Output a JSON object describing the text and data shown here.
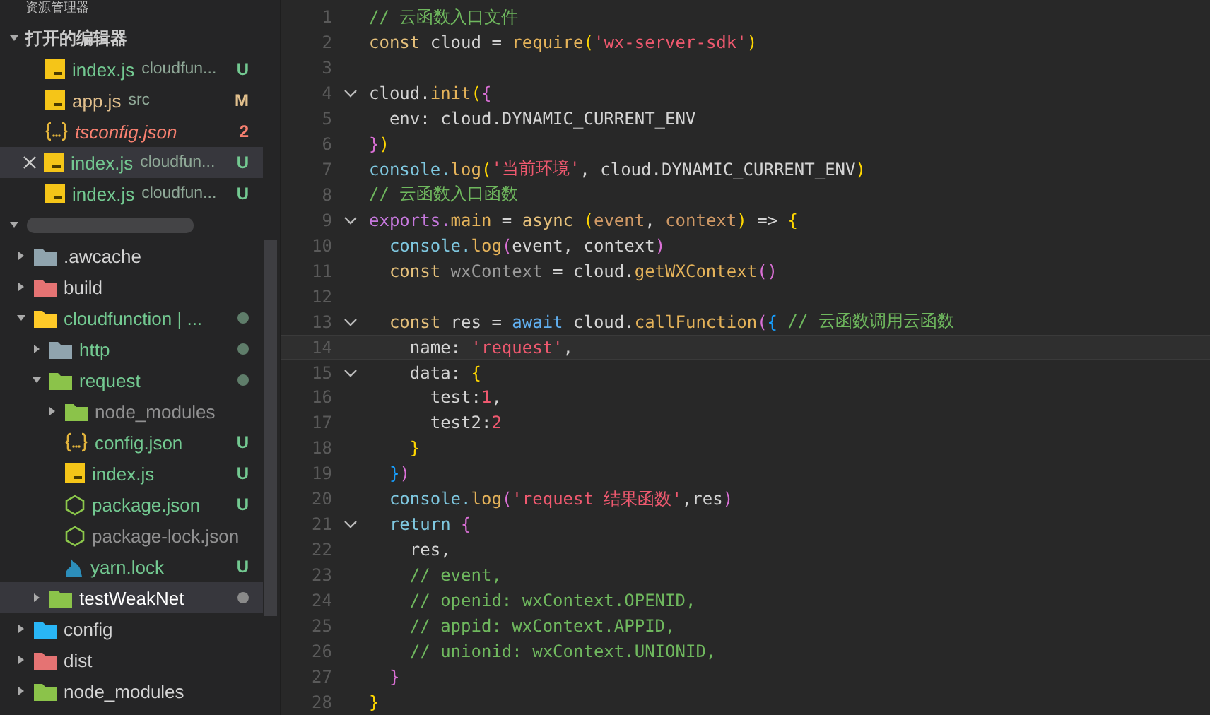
{
  "sidebar": {
    "title": "资源管理器",
    "open_editors": {
      "label": "打开的编辑器",
      "expanded": true,
      "items": [
        {
          "name": "index.js",
          "path": "cloudfun...",
          "badge": "U",
          "kind": "js",
          "color": "#73c991",
          "error": false,
          "selected": false
        },
        {
          "name": "app.js",
          "path": "src",
          "badge": "M",
          "kind": "js",
          "color": "#e2c08d",
          "error": false,
          "selected": false
        },
        {
          "name": "tsconfig.json",
          "badge": "2",
          "kind": "json",
          "color": "#f88070",
          "error": true,
          "selected": false
        },
        {
          "name": "index.js",
          "path": "cloudfun...",
          "badge": "U",
          "kind": "js",
          "color": "#73c991",
          "error": false,
          "selected": true
        },
        {
          "name": "index.js",
          "path": "cloudfun...",
          "badge": "U",
          "kind": "js",
          "color": "#73c991",
          "error": false,
          "selected": false
        }
      ]
    },
    "project": {
      "expanded": true
    },
    "tree": [
      {
        "name": ".awcache",
        "kind": "folder",
        "color": "#90a4ae",
        "expanded": false,
        "untracked": false,
        "ignored": false,
        "dot": false,
        "selected": false
      },
      {
        "name": "build",
        "kind": "folder",
        "color": "#e57373",
        "expanded": false,
        "untracked": false,
        "ignored": false,
        "dot": false,
        "selected": false
      },
      {
        "name": "cloudfunction | ...",
        "kind": "folder",
        "color": "#ffca28",
        "expanded": true,
        "untracked": true,
        "ignored": false,
        "dot": true,
        "selected": false,
        "children": [
          {
            "name": "http",
            "kind": "folder",
            "color": "#90a4ae",
            "expanded": false,
            "untracked": true,
            "ignored": false,
            "dot": true,
            "selected": false
          },
          {
            "name": "request",
            "kind": "folder",
            "color": "#8bc34a",
            "expanded": true,
            "untracked": true,
            "ignored": false,
            "dot": true,
            "selected": false,
            "children": [
              {
                "name": "node_modules",
                "kind": "folder",
                "color": "#8bc34a",
                "expanded": false,
                "untracked": false,
                "ignored": true,
                "dot": false,
                "selected": false
              },
              {
                "name": "config.json",
                "kind": "json",
                "badge": "U",
                "untracked": true,
                "ignored": false,
                "dot": false,
                "selected": false
              },
              {
                "name": "index.js",
                "kind": "js",
                "badge": "U",
                "untracked": true,
                "ignored": false,
                "dot": false,
                "selected": false
              },
              {
                "name": "package.json",
                "kind": "node",
                "badge": "U",
                "untracked": true,
                "ignored": false,
                "dot": false,
                "selected": false
              },
              {
                "name": "package-lock.json",
                "kind": "node",
                "untracked": false,
                "ignored": true,
                "dot": false,
                "selected": false
              },
              {
                "name": "yarn.lock",
                "kind": "yarn",
                "badge": "U",
                "untracked": true,
                "ignored": false,
                "dot": false,
                "selected": false
              }
            ]
          },
          {
            "name": "testWeakNet",
            "kind": "folder",
            "color": "#8bc34a",
            "expanded": false,
            "untracked": false,
            "ignored": false,
            "dot": true,
            "selected": true
          }
        ]
      },
      {
        "name": "config",
        "kind": "folder",
        "color": "#29b6f6",
        "expanded": false,
        "untracked": false,
        "ignored": false,
        "dot": false,
        "selected": false
      },
      {
        "name": "dist",
        "kind": "folder",
        "color": "#e57373",
        "expanded": false,
        "untracked": false,
        "ignored": false,
        "dot": false,
        "selected": false
      },
      {
        "name": "node_modules",
        "kind": "folder",
        "color": "#8bc34a",
        "expanded": false,
        "untracked": false,
        "ignored": false,
        "dot": false,
        "selected": false
      }
    ]
  },
  "editor": {
    "lines": [
      {
        "number": "1",
        "fold": false,
        "current": false,
        "tokens": [
          {
            "kind": "cm",
            "text": "// 云函数入口文件"
          }
        ]
      },
      {
        "number": "2",
        "fold": false,
        "current": false,
        "tokens": [
          {
            "kind": "kw",
            "text": "const"
          },
          {
            "kind": "pl",
            "text": " cloud = "
          },
          {
            "kind": "fn",
            "text": "require"
          },
          {
            "kind": "b1",
            "text": "("
          },
          {
            "kind": "str",
            "text": "'wx-server-sdk'"
          },
          {
            "kind": "b1",
            "text": ")"
          }
        ]
      },
      {
        "number": "3",
        "fold": false,
        "current": false
      },
      {
        "number": "4",
        "fold": true,
        "current": false,
        "tokens": [
          {
            "kind": "pl",
            "text": "cloud."
          },
          {
            "kind": "fn",
            "text": "init"
          },
          {
            "kind": "b1",
            "text": "("
          },
          {
            "kind": "b2",
            "text": "{"
          }
        ]
      },
      {
        "number": "5",
        "fold": false,
        "current": false,
        "tokens": [
          {
            "kind": "pl",
            "text": "  env: cloud.DYNAMIC_CURRENT_ENV"
          }
        ]
      },
      {
        "number": "6",
        "fold": false,
        "current": false,
        "tokens": [
          {
            "kind": "b2",
            "text": "}"
          },
          {
            "kind": "b1",
            "text": ")"
          }
        ]
      },
      {
        "number": "7",
        "fold": false,
        "current": false,
        "tokens": [
          {
            "kind": "obj",
            "text": "console."
          },
          {
            "kind": "fn",
            "text": "log"
          },
          {
            "kind": "b1",
            "text": "("
          },
          {
            "kind": "str",
            "text": "'当前环境'"
          },
          {
            "kind": "pl",
            "text": ", cloud.DYNAMIC_CURRENT_ENV"
          },
          {
            "kind": "b1",
            "text": ")"
          }
        ]
      },
      {
        "number": "8",
        "fold": false,
        "current": false,
        "tokens": [
          {
            "kind": "cm",
            "text": "// 云函数入口函数"
          }
        ]
      },
      {
        "number": "9",
        "fold": true,
        "current": false,
        "tokens": [
          {
            "kind": "pur",
            "text": "exports."
          },
          {
            "kind": "fn",
            "text": "main"
          },
          {
            "kind": "pl",
            "text": " = "
          },
          {
            "kind": "kw",
            "text": "async "
          },
          {
            "kind": "b1",
            "text": "("
          },
          {
            "kind": "param",
            "text": "event"
          },
          {
            "kind": "pl",
            "text": ", "
          },
          {
            "kind": "param",
            "text": "context"
          },
          {
            "kind": "b1",
            "text": ")"
          },
          {
            "kind": "pl",
            "text": " => "
          },
          {
            "kind": "b1",
            "text": "{"
          }
        ]
      },
      {
        "number": "10",
        "fold": false,
        "current": false,
        "tokens": [
          {
            "kind": "obj",
            "text": "  console."
          },
          {
            "kind": "fn",
            "text": "log"
          },
          {
            "kind": "b2",
            "text": "("
          },
          {
            "kind": "pl",
            "text": "event, context"
          },
          {
            "kind": "b2",
            "text": ")"
          }
        ]
      },
      {
        "number": "11",
        "fold": false,
        "current": false,
        "tokens": [
          {
            "kind": "kw",
            "text": "  const "
          },
          {
            "kind": "dim",
            "text": "wxContext"
          },
          {
            "kind": "pl",
            "text": " = cloud."
          },
          {
            "kind": "fn",
            "text": "getWXContext"
          },
          {
            "kind": "b2",
            "text": "()"
          }
        ]
      },
      {
        "number": "12",
        "fold": false,
        "current": false
      },
      {
        "number": "13",
        "fold": true,
        "current": false,
        "tokens": [
          {
            "kind": "kw",
            "text": "  const"
          },
          {
            "kind": "pl",
            "text": " res = "
          },
          {
            "kind": "blue",
            "text": "await"
          },
          {
            "kind": "pl",
            "text": " cloud."
          },
          {
            "kind": "fn",
            "text": "callFunction"
          },
          {
            "kind": "b2",
            "text": "("
          },
          {
            "kind": "b3",
            "text": "{"
          },
          {
            "kind": "cm",
            "text": " // 云函数调用云函数"
          }
        ]
      },
      {
        "number": "14",
        "fold": false,
        "current": true,
        "tokens": [
          {
            "kind": "pl",
            "text": "    name: "
          },
          {
            "kind": "str",
            "text": "'request'"
          },
          {
            "kind": "pl",
            "text": ","
          }
        ]
      },
      {
        "number": "15",
        "fold": true,
        "current": false,
        "tokens": [
          {
            "kind": "pl",
            "text": "    data: "
          },
          {
            "kind": "b1",
            "text": "{"
          }
        ]
      },
      {
        "number": "16",
        "fold": false,
        "current": false,
        "tokens": [
          {
            "kind": "pl",
            "text": "      test:"
          },
          {
            "kind": "num",
            "text": "1"
          },
          {
            "kind": "pl",
            "text": ","
          }
        ]
      },
      {
        "number": "17",
        "fold": false,
        "current": false,
        "tokens": [
          {
            "kind": "pl",
            "text": "      test2:"
          },
          {
            "kind": "num",
            "text": "2"
          }
        ]
      },
      {
        "number": "18",
        "fold": false,
        "current": false,
        "tokens": [
          {
            "kind": "b1",
            "text": "    }"
          }
        ]
      },
      {
        "number": "19",
        "fold": false,
        "current": false,
        "tokens": [
          {
            "kind": "b3",
            "text": "  }"
          },
          {
            "kind": "b2",
            "text": ")"
          }
        ]
      },
      {
        "number": "20",
        "fold": false,
        "current": false,
        "tokens": [
          {
            "kind": "obj",
            "text": "  console."
          },
          {
            "kind": "fn",
            "text": "log"
          },
          {
            "kind": "b2",
            "text": "("
          },
          {
            "kind": "str",
            "text": "'request 结果函数'"
          },
          {
            "kind": "pl",
            "text": ",res"
          },
          {
            "kind": "b2",
            "text": ")"
          }
        ]
      },
      {
        "number": "21",
        "fold": true,
        "current": false,
        "tokens": [
          {
            "kind": "obj",
            "text": "  return "
          },
          {
            "kind": "b2",
            "text": "{"
          }
        ]
      },
      {
        "number": "22",
        "fold": false,
        "current": false,
        "tokens": [
          {
            "kind": "pl",
            "text": "    res,"
          }
        ]
      },
      {
        "number": "23",
        "fold": false,
        "current": false,
        "tokens": [
          {
            "kind": "cm",
            "text": "    // event,"
          }
        ]
      },
      {
        "number": "24",
        "fold": false,
        "current": false,
        "tokens": [
          {
            "kind": "cm",
            "text": "    // openid: wxContext.OPENID,"
          }
        ]
      },
      {
        "number": "25",
        "fold": false,
        "current": false,
        "tokens": [
          {
            "kind": "cm",
            "text": "    // appid: wxContext.APPID,"
          }
        ]
      },
      {
        "number": "26",
        "fold": false,
        "current": false,
        "tokens": [
          {
            "kind": "cm",
            "text": "    // unionid: wxContext.UNIONID,"
          }
        ]
      },
      {
        "number": "27",
        "fold": false,
        "current": false,
        "tokens": [
          {
            "kind": "b2",
            "text": "  }"
          }
        ]
      },
      {
        "number": "28",
        "fold": false,
        "current": false,
        "tokens": [
          {
            "kind": "b1",
            "text": "}"
          }
        ]
      }
    ]
  }
}
